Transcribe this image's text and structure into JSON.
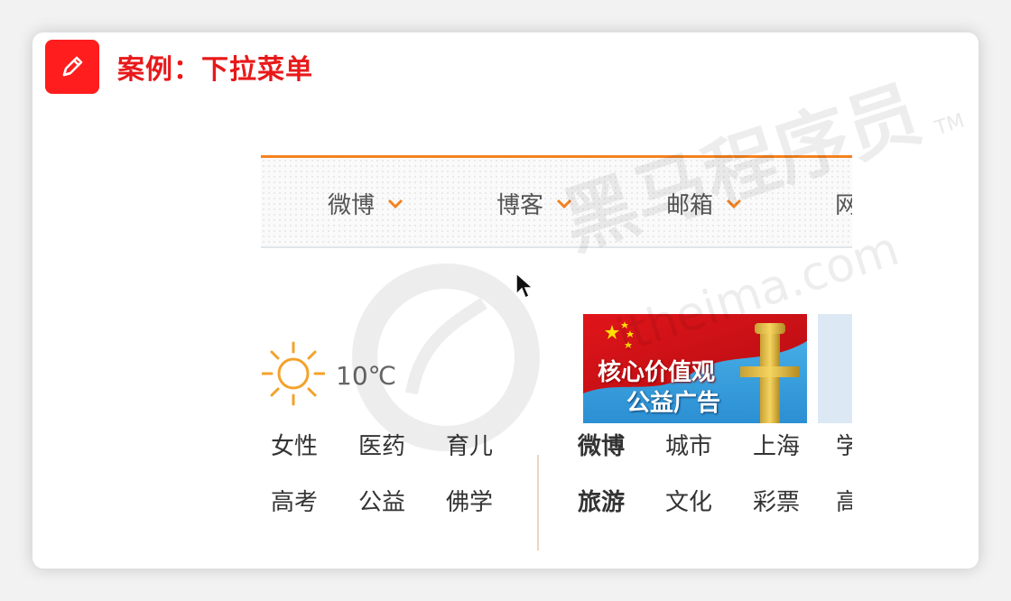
{
  "header": {
    "icon": "pencil-icon",
    "title": "案例：下拉菜单"
  },
  "colors": {
    "accent_red": "#e8191a",
    "icon_bg": "#ff1d1d",
    "nav_orange": "#f58220"
  },
  "nav": {
    "items": [
      {
        "label": "微博",
        "icon": "chevron-down-icon"
      },
      {
        "label": "博客",
        "icon": "chevron-down-icon"
      },
      {
        "label": "邮箱",
        "icon": "chevron-down-icon"
      },
      {
        "label": "网",
        "icon": "chevron-down-icon"
      }
    ]
  },
  "weather": {
    "icon": "sun-icon",
    "temperature": "10℃"
  },
  "banner": {
    "line1": "核心价值观",
    "line2": "公益广告"
  },
  "links": {
    "left": {
      "row1": [
        "女性",
        "医药",
        "育儿"
      ],
      "row2": [
        "高考",
        "公益",
        "佛学"
      ]
    },
    "right": {
      "row1": [
        "微博",
        "城市",
        "上海",
        "学"
      ],
      "row2": [
        "旅游",
        "文化",
        "彩票",
        "高"
      ]
    }
  },
  "watermark": {
    "brand": "黑马程序员",
    "tm": "TM",
    "url": "itheima.com"
  }
}
